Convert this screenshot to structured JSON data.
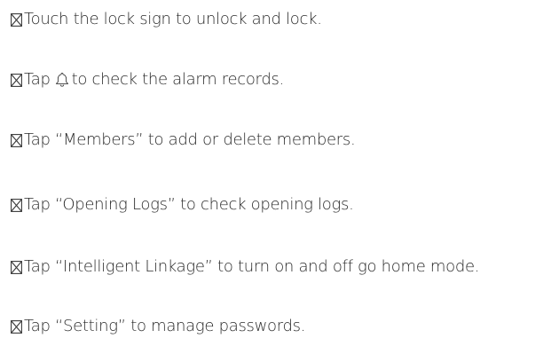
{
  "instructions": [
    {
      "id": "lock",
      "text": "Touch the lock sign to unlock and lock."
    },
    {
      "id": "alarm",
      "before": "Tap",
      "after": "to check the alarm records."
    },
    {
      "id": "members",
      "text": "Tap “Members” to add or delete members."
    },
    {
      "id": "logs",
      "text": "Tap “Opening Logs” to check opening logs."
    },
    {
      "id": "linkage",
      "text": "Tap “Intelligent Linkage” to turn on and off go home mode."
    },
    {
      "id": "setting",
      "text": "Tap “Setting” to manage passwords."
    }
  ],
  "icons": {
    "bullet": "crossed-box-icon",
    "alarm": "bell-icon"
  },
  "colors": {
    "text": "#2a2a2a",
    "icon": "#3a3a3a"
  }
}
